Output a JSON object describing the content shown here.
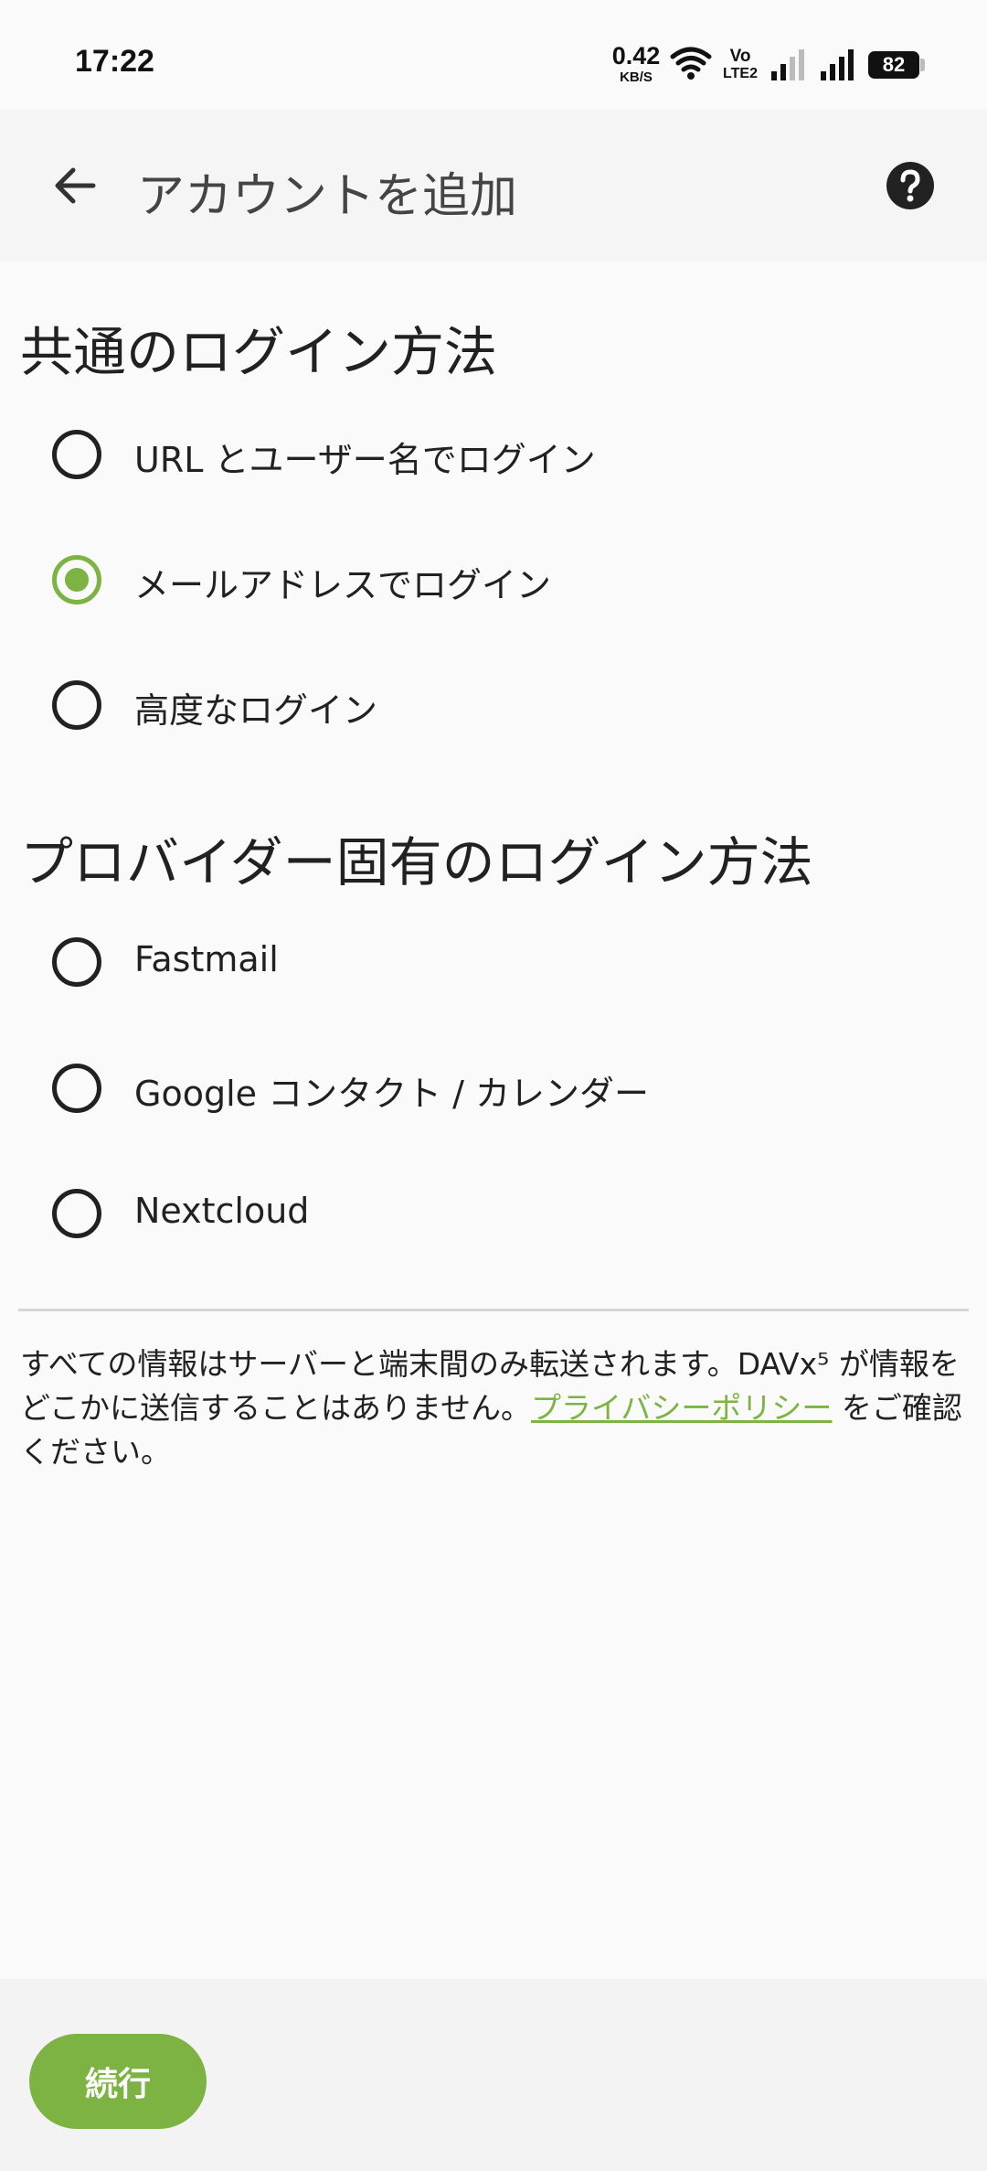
{
  "status_bar": {
    "time": "17:22",
    "net_speed_value": "0.42",
    "net_speed_unit": "KB/S",
    "volte_top": "Vo",
    "volte_bottom": "LTE2",
    "battery": "82"
  },
  "app_bar": {
    "title": "アカウントを追加",
    "back_icon": "arrow-back-icon",
    "help_icon": "help-circle-icon"
  },
  "common": {
    "heading": "共通のログイン方法",
    "options": [
      {
        "label": "URL とユーザー名でログイン",
        "selected": false
      },
      {
        "label": "メールアドレスでログイン",
        "selected": true
      },
      {
        "label": "高度なログイン",
        "selected": false
      }
    ]
  },
  "provider": {
    "heading": "プロバイダー固有のログイン方法",
    "options": [
      {
        "label": "Fastmail",
        "selected": false
      },
      {
        "label": "Google コンタクト / カレンダー",
        "selected": false
      },
      {
        "label": "Nextcloud",
        "selected": false
      }
    ]
  },
  "info": {
    "text_before": "すべての情報はサーバーと端末間のみ転送されます。DAVx⁵ が情報をどこかに送信することはありません。",
    "link": "プライバシーポリシー",
    "text_after": " をご確認ください。"
  },
  "footer": {
    "continue_label": "続行"
  },
  "colors": {
    "accent": "#7cb342",
    "app_bar_bg": "#f5f5f5",
    "background": "#fafafa"
  }
}
